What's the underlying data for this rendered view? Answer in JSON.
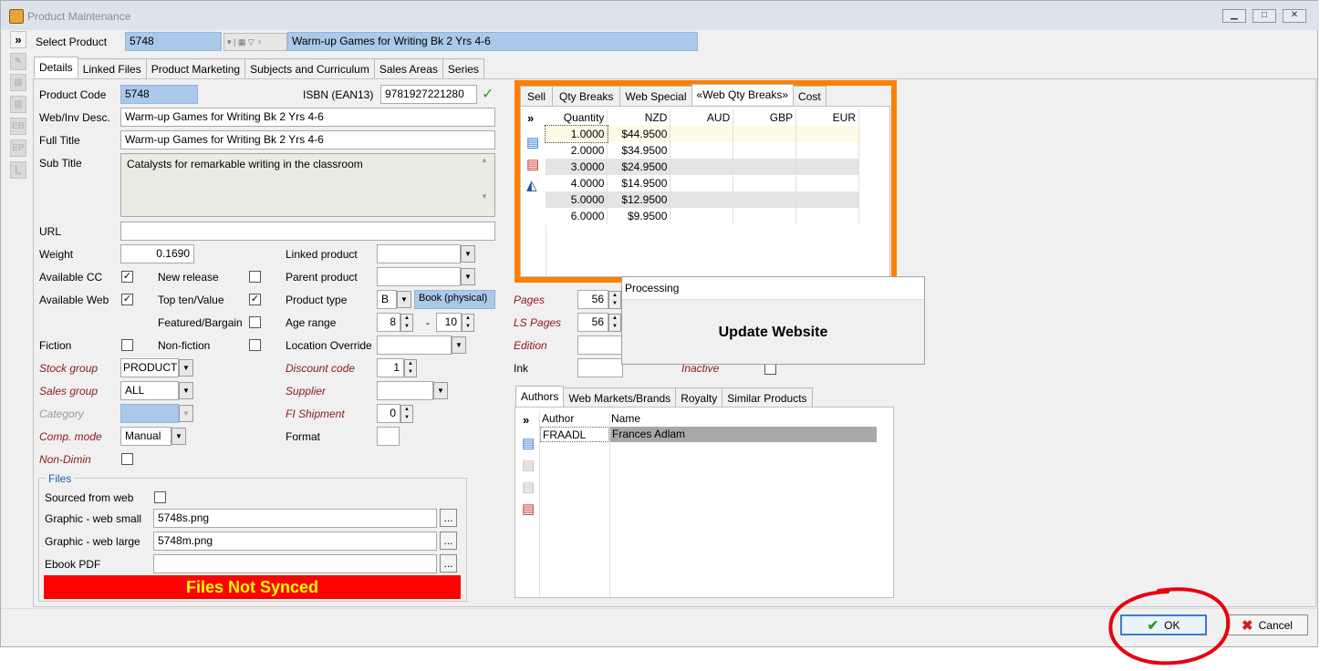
{
  "window": {
    "title": "Product Maintenance"
  },
  "select": {
    "label": "Select Product",
    "code": "5748",
    "name": "Warm-up Games for Writing Bk 2 Yrs 4-6"
  },
  "tabs": [
    "Details",
    "Linked Files",
    "Product Marketing",
    "Subjects and Curriculum",
    "Sales Areas",
    "Series"
  ],
  "fields": {
    "product_code_label": "Product Code",
    "product_code": "5748",
    "isbn_label": "ISBN (EAN13)",
    "isbn": "9781927221280",
    "webdesc_label": "Web/Inv Desc.",
    "webdesc": "Warm-up Games for Writing Bk 2 Yrs 4-6",
    "fulltitle_label": "Full Title",
    "fulltitle": "Warm-up Games for Writing Bk 2 Yrs 4-6",
    "subtitle_label": "Sub Title",
    "subtitle": "Catalysts for remarkable writing in the classroom",
    "url_label": "URL",
    "url": "",
    "weight_label": "Weight",
    "weight": "0.1690",
    "avail_cc_label": "Available CC",
    "new_release_label": "New release",
    "avail_web_label": "Available Web",
    "top_ten_label": "Top ten/Value",
    "featured_label": "Featured/Bargain",
    "fiction_label": "Fiction",
    "nonfiction_label": "Non-fiction",
    "stock_group_label": "Stock group",
    "stock_group": "PRODUCT",
    "sales_group_label": "Sales group",
    "sales_group": "ALL",
    "category_label": "Category",
    "comp_mode_label": "Comp. mode",
    "comp_mode": "Manual",
    "non_dimin_label": "Non-Dimin",
    "linked_product_label": "Linked product",
    "parent_product_label": "Parent product",
    "product_type_label": "Product type",
    "product_type": "B",
    "product_type_desc": "Book (physical)",
    "age_range_label": "Age range",
    "age_from": "8",
    "age_dash": "-",
    "age_to": "10",
    "location_override_label": "Location Override",
    "discount_code_label": "Discount code",
    "discount_code": "1",
    "supplier_label": "Supplier",
    "fi_shipment_label": "FI Shipment",
    "fi_shipment": "0",
    "format_label": "Format",
    "pages_label": "Pages",
    "pages": "56",
    "ls_pages_label": "LS Pages",
    "ls_pages": "56",
    "edition_label": "Edition",
    "ink_label": "Ink",
    "inactive_label": "Inactive"
  },
  "files": {
    "legend": "Files",
    "sourced_label": "Sourced from web",
    "small_label": "Graphic - web small",
    "small": "5748s.png",
    "large_label": "Graphic - web large",
    "large": "5748m.png",
    "ebook_label": "Ebook PDF",
    "ebook": "",
    "browse": "...",
    "status": "Files Not Synced"
  },
  "price_tabs": [
    "Sell",
    "Qty Breaks",
    "Web Special",
    "«Web Qty Breaks»",
    "Cost"
  ],
  "price_grid": {
    "headers": [
      "Quantity",
      "NZD",
      "AUD",
      "GBP",
      "EUR"
    ],
    "rows": [
      [
        "1.0000",
        "$44.9500",
        "",
        "",
        ""
      ],
      [
        "2.0000",
        "$34.9500",
        "",
        "",
        ""
      ],
      [
        "3.0000",
        "$24.9500",
        "",
        "",
        ""
      ],
      [
        "4.0000",
        "$14.9500",
        "",
        "",
        ""
      ],
      [
        "5.0000",
        "$12.9500",
        "",
        "",
        ""
      ],
      [
        "6.0000",
        "$9.9500",
        "",
        "",
        ""
      ]
    ]
  },
  "author_tabs": [
    "Authors",
    "Web Markets/Brands",
    "Royalty",
    "Similar Products"
  ],
  "author_grid": {
    "headers": [
      "Author",
      "Name"
    ],
    "rows": [
      [
        "FRAADL",
        "Frances Adlam"
      ]
    ]
  },
  "processing": {
    "title": "Processing",
    "message": "Update Website"
  },
  "buttons": {
    "ok": "OK",
    "cancel": "Cancel",
    "expand": "»"
  },
  "colors": {
    "highlight": "#ff7f00",
    "alert_bg": "#ff0000",
    "alert_text": "#ffff00",
    "annotation": "#e8000e"
  }
}
